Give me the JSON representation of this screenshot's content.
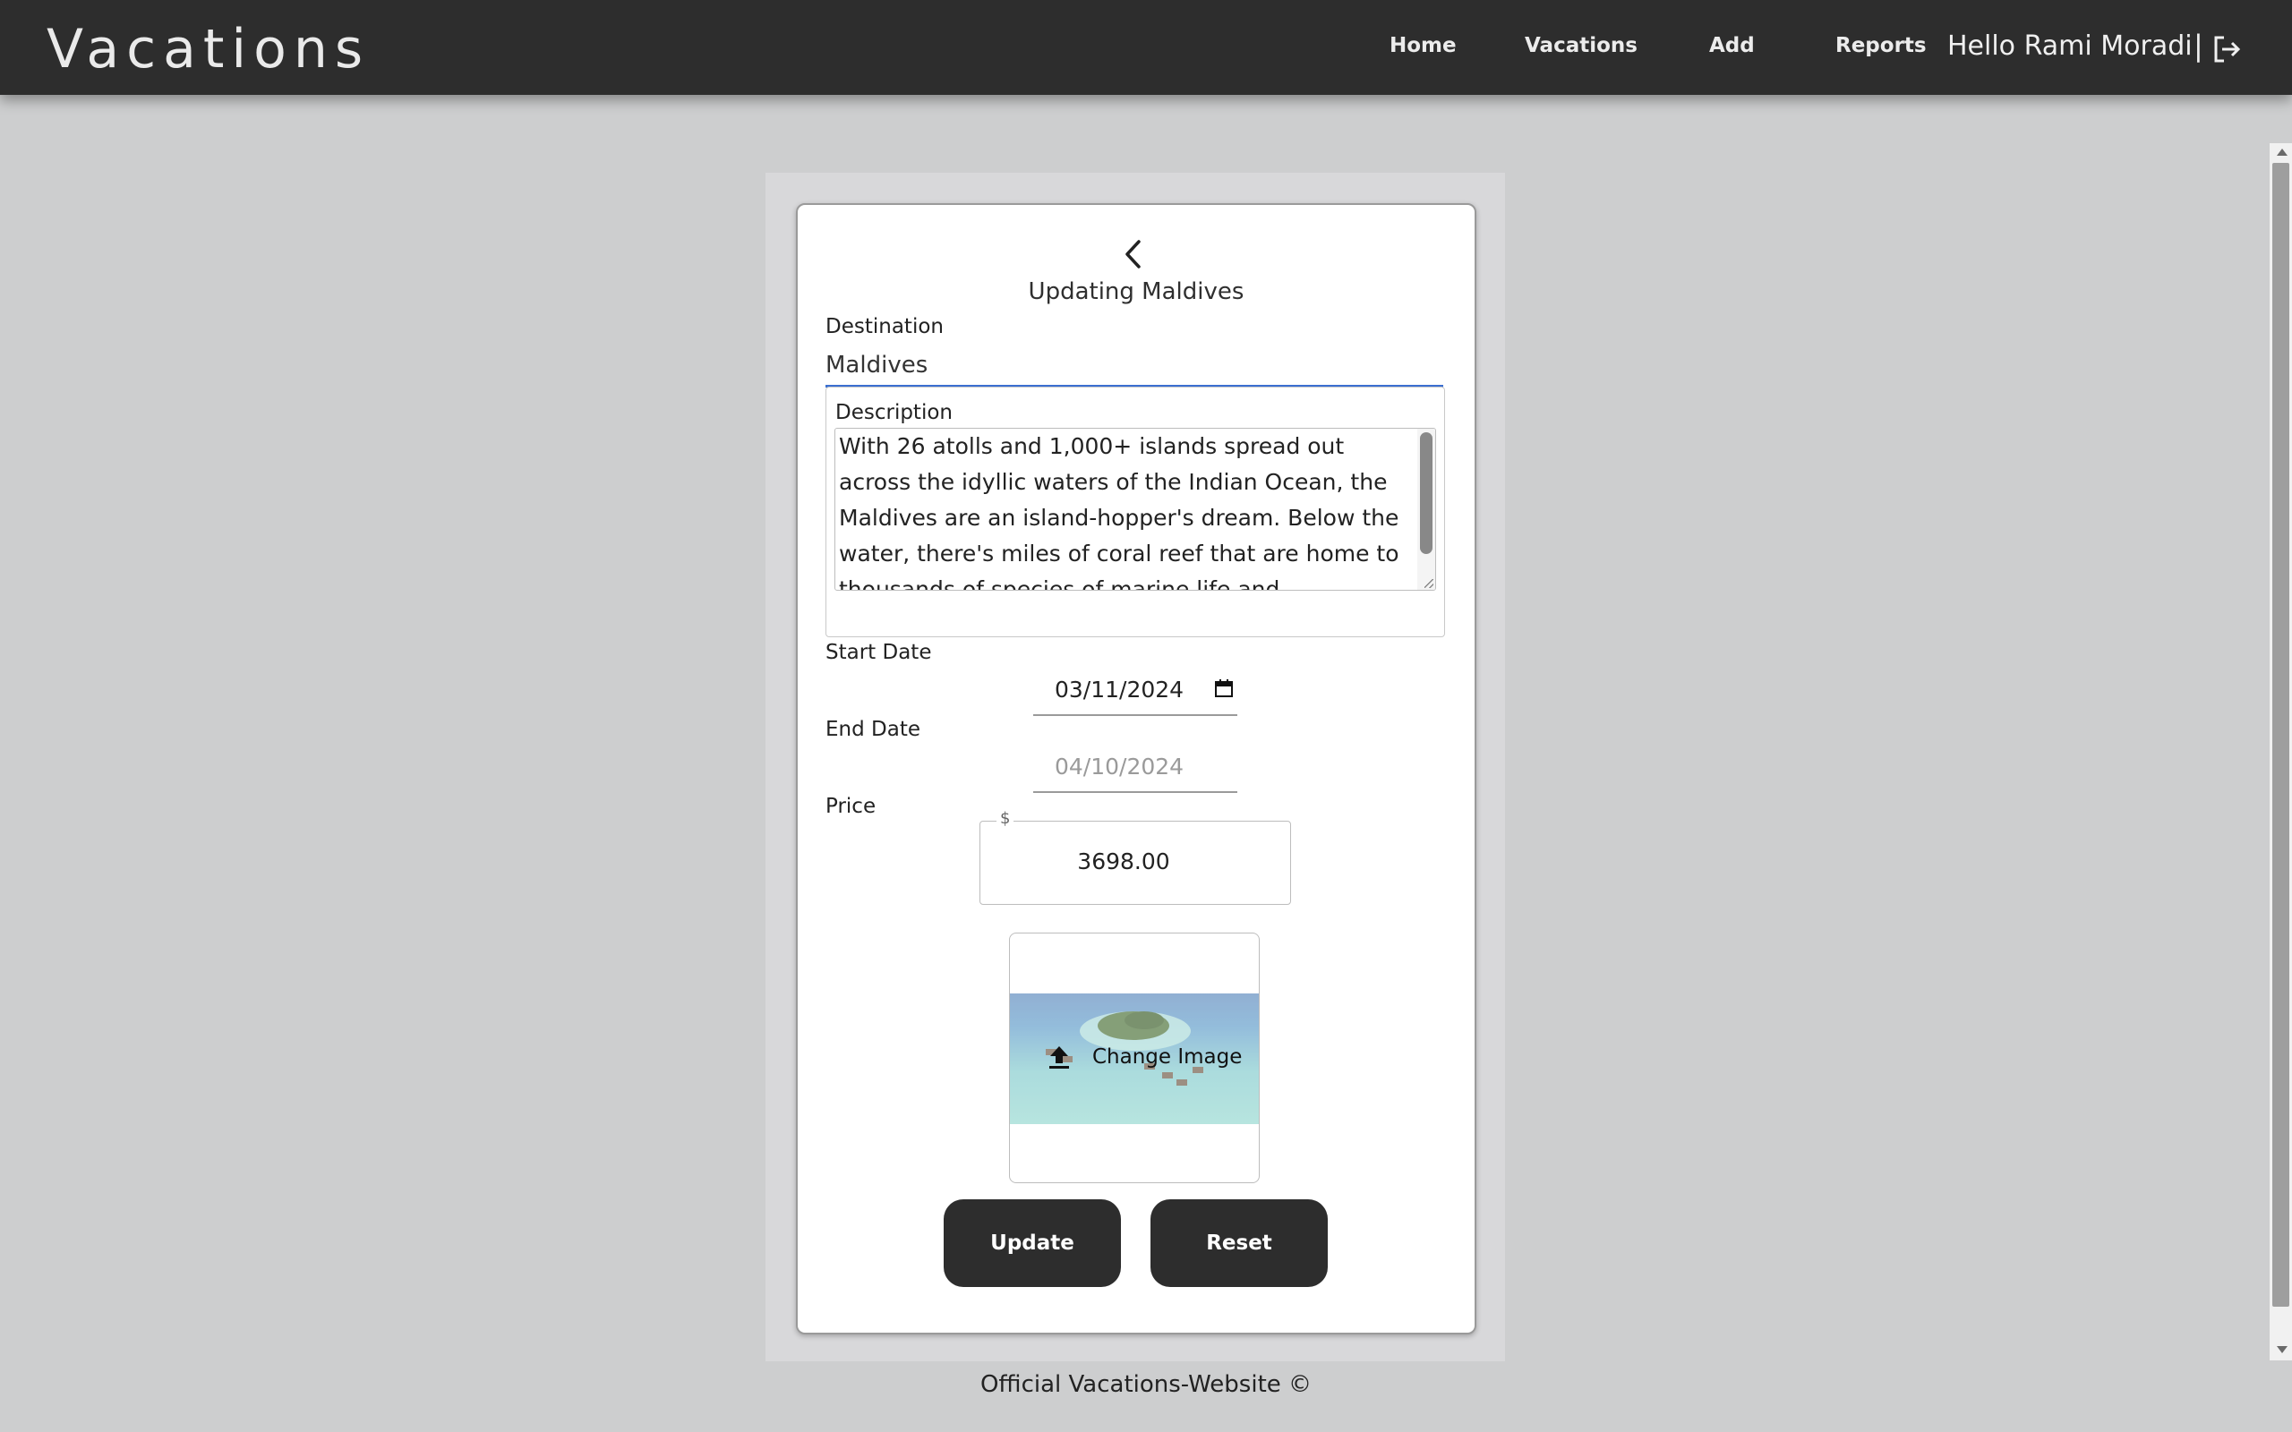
{
  "app": {
    "brand": "Vacations",
    "greeting": "Hello Rami Moradi",
    "separator": "|"
  },
  "nav": {
    "home": "Home",
    "vacations": "Vacations",
    "add": "Add",
    "reports": "Reports"
  },
  "form": {
    "title": "Updating Maldives",
    "destination_label": "Destination",
    "destination_value": "Maldives",
    "description_label": "Description",
    "description_value": "With 26 atolls and 1,000+ islands spread out across the idyllic waters of the Indian Ocean, the Maldives are an island-hopper's dream. Below the water, there's miles of coral reef that are home to thousands of species of marine life and underwater treasures.",
    "start_date_label": "Start Date",
    "start_date_value": "03/11/2024",
    "end_date_label": "End Date",
    "end_date_value": "04/10/2024",
    "price_label": "Price",
    "price_prefix": "$",
    "price_value": "3698.00",
    "change_image_label": "Change Image",
    "update_button": "Update",
    "reset_button": "Reset"
  },
  "footer": {
    "text": "Official Vacations-Website ©"
  },
  "colors": {
    "topbar": "#2d2d2d",
    "background": "#cdcecf",
    "button": "#2d2d2d",
    "focus_underline": "#3b6fd0"
  },
  "icons": [
    "logout-icon",
    "back-chevron-icon",
    "calendar-icon",
    "upload-icon"
  ]
}
